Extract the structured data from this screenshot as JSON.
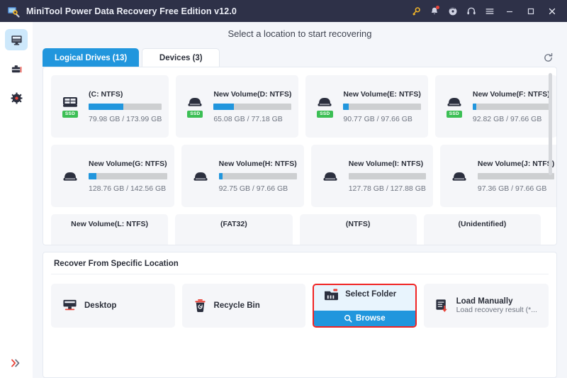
{
  "window": {
    "title": "MiniTool Power Data Recovery Free Edition v12.0",
    "logo_icon": "minitool-logo-icon",
    "controls": [
      {
        "name": "key-icon",
        "glyph": "key"
      },
      {
        "name": "notification-bell-icon",
        "glyph": "bell",
        "badge": true
      },
      {
        "name": "disc-icon",
        "glyph": "disc"
      },
      {
        "name": "headset-support-icon",
        "glyph": "headset"
      },
      {
        "name": "menu-icon",
        "glyph": "menu"
      },
      {
        "name": "minimize-button",
        "glyph": "minimize"
      },
      {
        "name": "maximize-button",
        "glyph": "maximize"
      },
      {
        "name": "close-button",
        "glyph": "close"
      }
    ],
    "accent_color": "#2196dd",
    "titlebar_color": "#2e3148",
    "highlight_color": "#f02424"
  },
  "sidebar": {
    "items": [
      {
        "name": "sidebar-item-this-pc",
        "icon": "monitor-icon",
        "active": true
      },
      {
        "name": "sidebar-item-tools",
        "icon": "toolbox-icon",
        "active": false
      },
      {
        "name": "sidebar-item-settings",
        "icon": "gear-icon",
        "active": false
      }
    ],
    "expand": {
      "name": "expand-sidebar-button",
      "icon": "double-chevron-right-icon"
    }
  },
  "header": {
    "title": "Select a location to start recovering"
  },
  "tabs": [
    {
      "label": "Logical Drives (13)",
      "active": true
    },
    {
      "label": "Devices (3)",
      "active": false
    }
  ],
  "refresh": {
    "icon": "refresh-icon",
    "label": "Refresh"
  },
  "drives": {
    "rows": [
      [
        {
          "name": "(C: NTFS)",
          "size": "79.98 GB / 173.99 GB",
          "percent": 47,
          "ssd": true,
          "icon": "system-drive-icon"
        },
        {
          "name": "New Volume(D: NTFS)",
          "size": "65.08 GB / 77.18 GB",
          "percent": 26,
          "ssd": true,
          "icon": "drive-icon"
        },
        {
          "name": "New Volume(E: NTFS)",
          "size": "90.77 GB / 97.66 GB",
          "percent": 7,
          "ssd": true,
          "icon": "drive-icon"
        },
        {
          "name": "New Volume(F: NTFS)",
          "size": "92.82 GB / 97.66 GB",
          "percent": 5,
          "ssd": true,
          "icon": "drive-icon"
        }
      ],
      [
        {
          "name": "New Volume(G: NTFS)",
          "size": "128.76 GB / 142.56 GB",
          "percent": 10,
          "ssd": false,
          "icon": "drive-icon"
        },
        {
          "name": "New Volume(H: NTFS)",
          "size": "92.75 GB / 97.66 GB",
          "percent": 5,
          "ssd": false,
          "icon": "drive-icon"
        },
        {
          "name": "New Volume(I: NTFS)",
          "size": "127.78 GB / 127.88 GB",
          "percent": 0,
          "ssd": false,
          "icon": "drive-icon"
        },
        {
          "name": "New Volume(J: NTFS)",
          "size": "97.36 GB / 97.66 GB",
          "percent": 0,
          "ssd": false,
          "icon": "drive-icon"
        }
      ]
    ],
    "partial_row": [
      {
        "name": "New Volume(L: NTFS)"
      },
      {
        "name": "(FAT32)"
      },
      {
        "name": "(NTFS)"
      },
      {
        "name": "(Unidentified)"
      }
    ]
  },
  "recover": {
    "title": "Recover From Specific Location",
    "cards": [
      {
        "label": "Desktop",
        "sub": "",
        "icon": "desktop-icon",
        "selected": false
      },
      {
        "label": "Recycle Bin",
        "sub": "",
        "icon": "recycle-bin-icon",
        "selected": false
      },
      {
        "label": "Select Folder",
        "sub": "",
        "icon": "folder-icon",
        "selected": true,
        "action": "Browse",
        "action_icon": "search-icon"
      },
      {
        "label": "Load Manually",
        "sub": "Load recovery result (*...",
        "icon": "load-file-icon",
        "selected": false
      }
    ]
  }
}
